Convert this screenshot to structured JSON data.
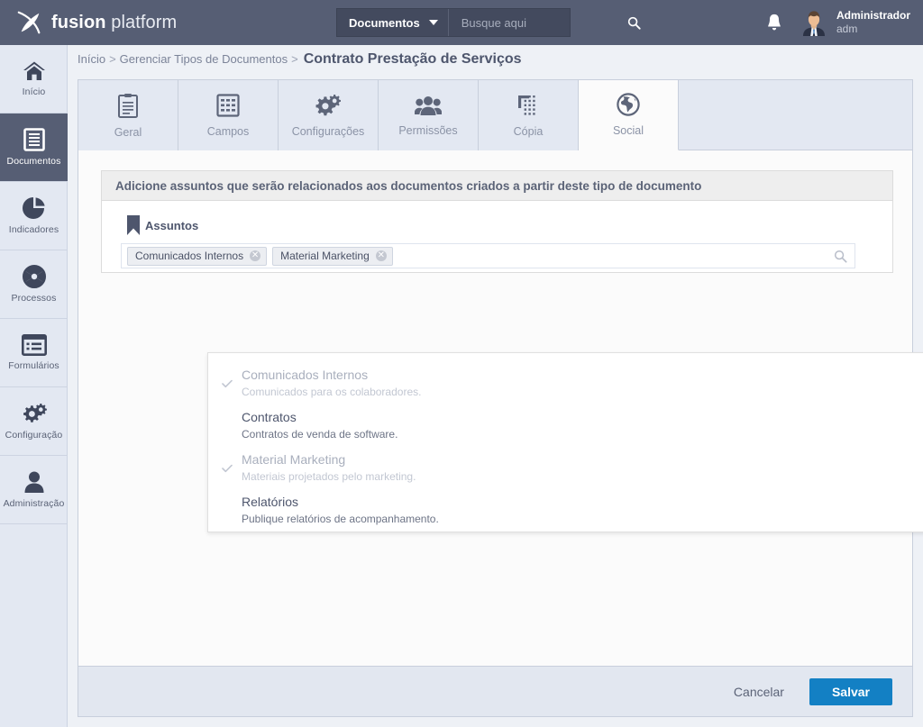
{
  "app": {
    "brand_bold": "fusion",
    "brand_light": " platform",
    "logo_icon": "fusion-swoosh-logo"
  },
  "header": {
    "search_scope": "Documentos",
    "search_placeholder": "Busque aqui",
    "search_value": "",
    "search_icon": "search-icon",
    "caret_icon": "chevron-down-icon",
    "notifications_icon": "bell-icon",
    "user_name": "Administrador",
    "user_login": "adm",
    "avatar_icon": "user-avatar"
  },
  "sidebar": {
    "items": [
      {
        "label": "Início",
        "icon": "home-icon",
        "active": false
      },
      {
        "label": "Documentos",
        "icon": "document-icon",
        "active": true
      },
      {
        "label": "Indicadores",
        "icon": "pie-chart-icon",
        "active": false
      },
      {
        "label": "Processos",
        "icon": "aperture-icon",
        "active": false
      },
      {
        "label": "Formulários",
        "icon": "form-list-icon",
        "active": false
      },
      {
        "label": "Configuração",
        "icon": "gears-icon",
        "active": false
      },
      {
        "label": "Administração",
        "icon": "person-icon",
        "active": false
      }
    ]
  },
  "breadcrumb": {
    "home": "Início",
    "sep": ">",
    "section": "Gerenciar Tipos de Documentos",
    "current": "Contrato Prestação de Serviços"
  },
  "tabs": [
    {
      "label": "Geral",
      "icon": "clipboard-icon",
      "active": false
    },
    {
      "label": "Campos",
      "icon": "grid-fields-icon",
      "active": false
    },
    {
      "label": "Configurações",
      "icon": "gears-icon",
      "active": false
    },
    {
      "label": "Permissões",
      "icon": "users-icon",
      "active": false
    },
    {
      "label": "Cópia",
      "icon": "copy-icon",
      "active": false
    },
    {
      "label": "Social",
      "icon": "globe-icon",
      "active": true
    }
  ],
  "card": {
    "header": "Adicione assuntos que serão relacionados aos documentos criados a partir deste tipo de documento",
    "field_label": "Assuntos",
    "field_icon": "bookmark-icon",
    "search_icon": "search-icon",
    "tokens": [
      {
        "label": "Comunicados Internos",
        "remove_icon": "close-circle-icon"
      },
      {
        "label": "Material Marketing",
        "remove_icon": "close-circle-icon"
      }
    ]
  },
  "dropdown": {
    "scroll_up_icon": "triangle-up-icon",
    "scroll_down_icon": "triangle-down-icon",
    "check_icon": "check-icon",
    "options": [
      {
        "title": "Comunicados Internos",
        "description": "Comunicados para os colaboradores.",
        "selected": true
      },
      {
        "title": "Contratos",
        "description": "Contratos de venda de software.",
        "selected": false
      },
      {
        "title": "Material Marketing",
        "description": "Materiais projetados pelo marketing.",
        "selected": true
      },
      {
        "title": "Relatórios",
        "description": "Publique relatórios de acompanhamento.",
        "selected": false
      }
    ]
  },
  "footer": {
    "cancel_label": "Cancelar",
    "save_label": "Salvar"
  },
  "colors": {
    "topbar": "#565e74",
    "sidebar": "#e3e8f2",
    "accent_primary": "#1380c4",
    "text_dark": "#4e566d",
    "text_muted": "#8b93a6",
    "footer": "#e2e7f0"
  }
}
